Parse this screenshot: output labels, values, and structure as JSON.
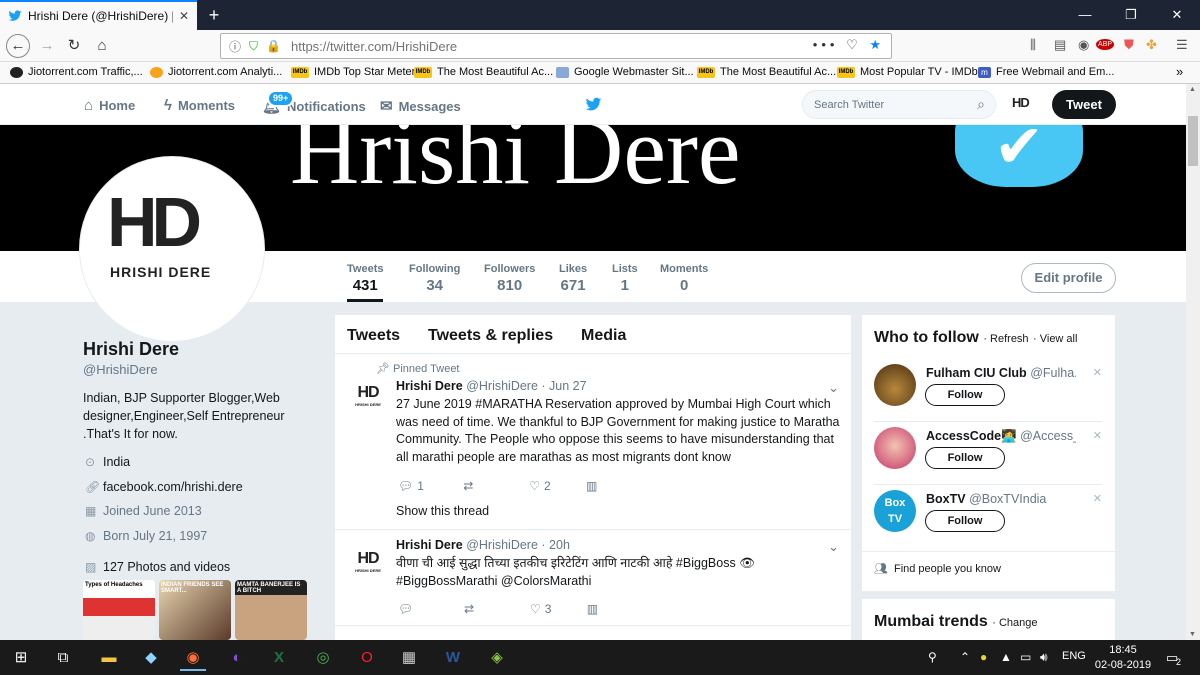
{
  "browser": {
    "tab_title": "Hrishi Dere (@HrishiDere) | Twitter",
    "new_tab": "+",
    "url": "https://twitter.com/HrishiDere",
    "url_more": "•••"
  },
  "bookmarks": [
    {
      "label": "Jiotorrent.com Traffic,...",
      "icon": "globe-icon"
    },
    {
      "label": "Jiotorrent.com Analyti...",
      "icon": "globe-icon"
    },
    {
      "label": "IMDb Top Star Meter",
      "icon": "imdb-icon"
    },
    {
      "label": "The Most Beautiful Ac...",
      "icon": "imdb-icon"
    },
    {
      "label": "Google Webmaster Sit...",
      "icon": "webmaster-icon"
    },
    {
      "label": "The Most Beautiful Ac...",
      "icon": "imdb-icon"
    },
    {
      "label": "Most Popular TV - IMDb",
      "icon": "imdb-icon"
    },
    {
      "label": "Free Webmail and Em...",
      "icon": "mail-icon"
    }
  ],
  "topnav": {
    "home": "Home",
    "moments": "Moments",
    "notifications": "Notifications",
    "notifications_badge": "99+",
    "messages": "Messages",
    "search_placeholder": "Search Twitter",
    "tweet_button": "Tweet",
    "avatar_text": "HD"
  },
  "banner": {
    "text": "Hrishi Dere"
  },
  "avatar": {
    "initials": "HD",
    "name": "HRISHI DERE"
  },
  "stats": [
    {
      "label": "Tweets",
      "value": "431"
    },
    {
      "label": "Following",
      "value": "34"
    },
    {
      "label": "Followers",
      "value": "810"
    },
    {
      "label": "Likes",
      "value": "671"
    },
    {
      "label": "Lists",
      "value": "1"
    },
    {
      "label": "Moments",
      "value": "0"
    }
  ],
  "edit_profile": "Edit profile",
  "profile": {
    "name": "Hrishi Dere",
    "handle": "@HrishiDere",
    "bio": "Indian, BJP Supporter Blogger,Web designer,Engineer,Self Entrepreneur .That's It for now.",
    "location": "India",
    "website": "facebook.com/hrishi.dere",
    "joined": "Joined June 2013",
    "born": "Born July 21, 1997",
    "media": "127 Photos and videos"
  },
  "thumbnails": [
    {
      "text": "Types of Headaches"
    },
    {
      "text": "INDIAN FRIENDS SEE SMART..."
    },
    {
      "text": "MAMTA BANERJEE IS A BITCH"
    }
  ],
  "timeline": {
    "tabs": [
      "Tweets",
      "Tweets & replies",
      "Media"
    ],
    "tweets": [
      {
        "pinned": "Pinned Tweet",
        "name": "Hrishi Dere",
        "handle": "@HrishiDere",
        "date": "· Jun 27",
        "text": "27 June 2019 #MARATHA Reservation approved by Mumbai High Court which was need of time. We thankful to BJP Government for making justice to Maratha Community. The People who oppose this seems to have misunderstanding that all marathi people are marathas as most migrants dont know",
        "replies": "1",
        "likes": "2",
        "thread": "Show this thread"
      },
      {
        "name": "Hrishi Dere",
        "handle": "@HrishiDere",
        "date": "· 20h",
        "text": "वीणा ची आई सुद्धा तिच्या इतकीच इरिटेटिंग आणि नाटकी आहे #BiggBoss 👁 #BiggBossMarathi @ColorsMarathi",
        "replies": "",
        "likes": "3"
      }
    ]
  },
  "who_to_follow": {
    "title": "Who to follow",
    "refresh": "· Refresh",
    "view_all": "· View all",
    "follow_label": "Follow",
    "users": [
      {
        "name": "Fulham CIU Club",
        "handle": "@Fulha..."
      },
      {
        "name": "AccessCode",
        "handle": "@Access_s..."
      },
      {
        "name": "BoxTV",
        "handle": "@BoxTVIndia"
      }
    ],
    "find_people": "Find people you know"
  },
  "trends": {
    "title": "Mumbai trends",
    "change": "· Change"
  },
  "taskbar": {
    "lang": "ENG",
    "time": "18:45",
    "date": "02-08-2019",
    "notif": "2"
  },
  "colors": {
    "twitter_blue": "#1da1f2",
    "dark": "#14171a",
    "muted": "#657786"
  }
}
